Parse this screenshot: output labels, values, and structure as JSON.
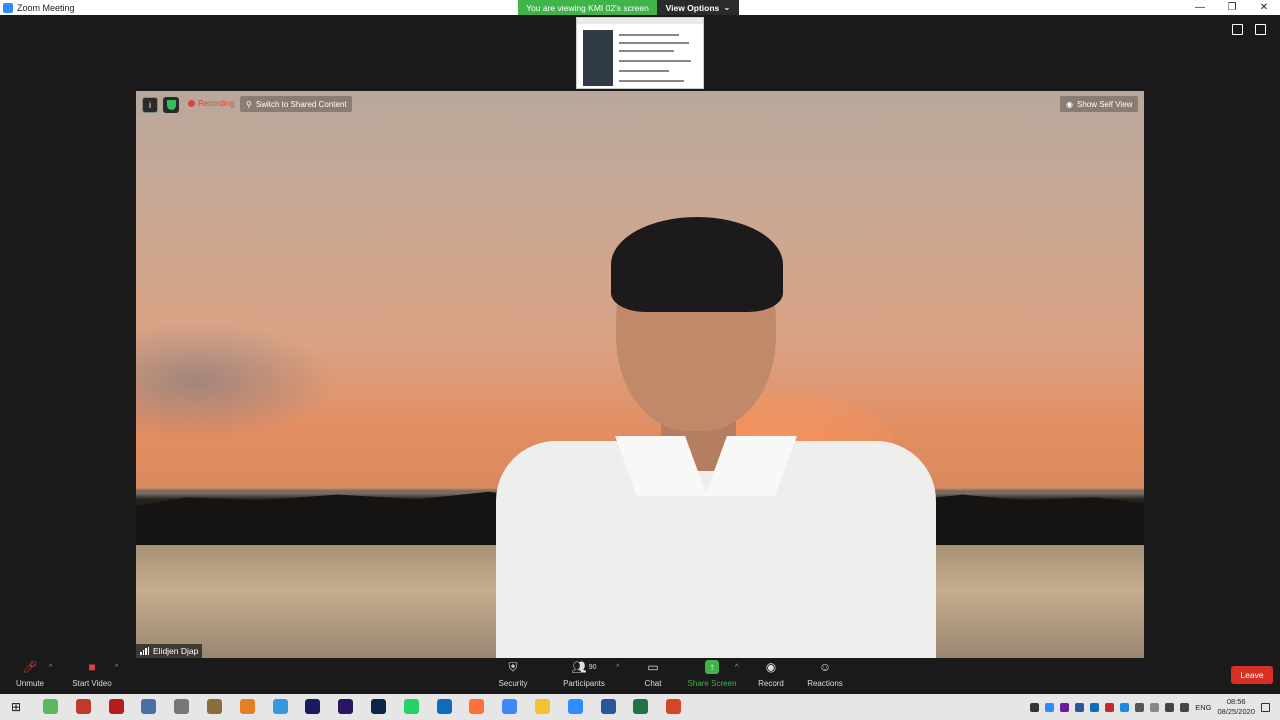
{
  "window": {
    "title": "Zoom Meeting",
    "buttons": [
      "—",
      "❐",
      "✕"
    ]
  },
  "banner": {
    "viewing": "You are viewing KMI 02's screen",
    "view_options": "View Options"
  },
  "video": {
    "recording": "Recording",
    "switch_shared": "Switch to Shared Content",
    "show_self_view": "Show Self View",
    "participant_name": "Elidjen Djap"
  },
  "toolbar": {
    "unmute": "Unmute",
    "start_video": "Start Video",
    "security": "Security",
    "participants": "Participants",
    "participants_count": "90",
    "chat": "Chat",
    "share_screen": "Share Screen",
    "record": "Record",
    "reactions": "Reactions",
    "leave": "Leave"
  },
  "taskbar": {
    "apps": [
      {
        "name": "maps",
        "color": "#5cb85c"
      },
      {
        "name": "app-red",
        "color": "#c0392b"
      },
      {
        "name": "flash",
        "color": "#b71c1c"
      },
      {
        "name": "calculator",
        "color": "#4a6fa5"
      },
      {
        "name": "sei",
        "color": "#777777"
      },
      {
        "name": "gimp",
        "color": "#8a6d3b"
      },
      {
        "name": "app-orange",
        "color": "#e67e22"
      },
      {
        "name": "paint",
        "color": "#3498db"
      },
      {
        "name": "media-encoder",
        "color": "#1a1a5e"
      },
      {
        "name": "premiere",
        "color": "#2a1660"
      },
      {
        "name": "photoshop",
        "color": "#0a2748"
      },
      {
        "name": "whatsapp",
        "color": "#25d366"
      },
      {
        "name": "outlook",
        "color": "#0f6cbd"
      },
      {
        "name": "firefox",
        "color": "#ff7139"
      },
      {
        "name": "chrome",
        "color": "#4285f4"
      },
      {
        "name": "file-explorer",
        "color": "#f1c232"
      },
      {
        "name": "zoom",
        "color": "#2d8cff"
      },
      {
        "name": "word",
        "color": "#2b579a"
      },
      {
        "name": "excel",
        "color": "#217346"
      },
      {
        "name": "powerpoint",
        "color": "#d24726"
      }
    ],
    "language": "ENG",
    "time": "08:56",
    "date": "08/25/2020"
  }
}
